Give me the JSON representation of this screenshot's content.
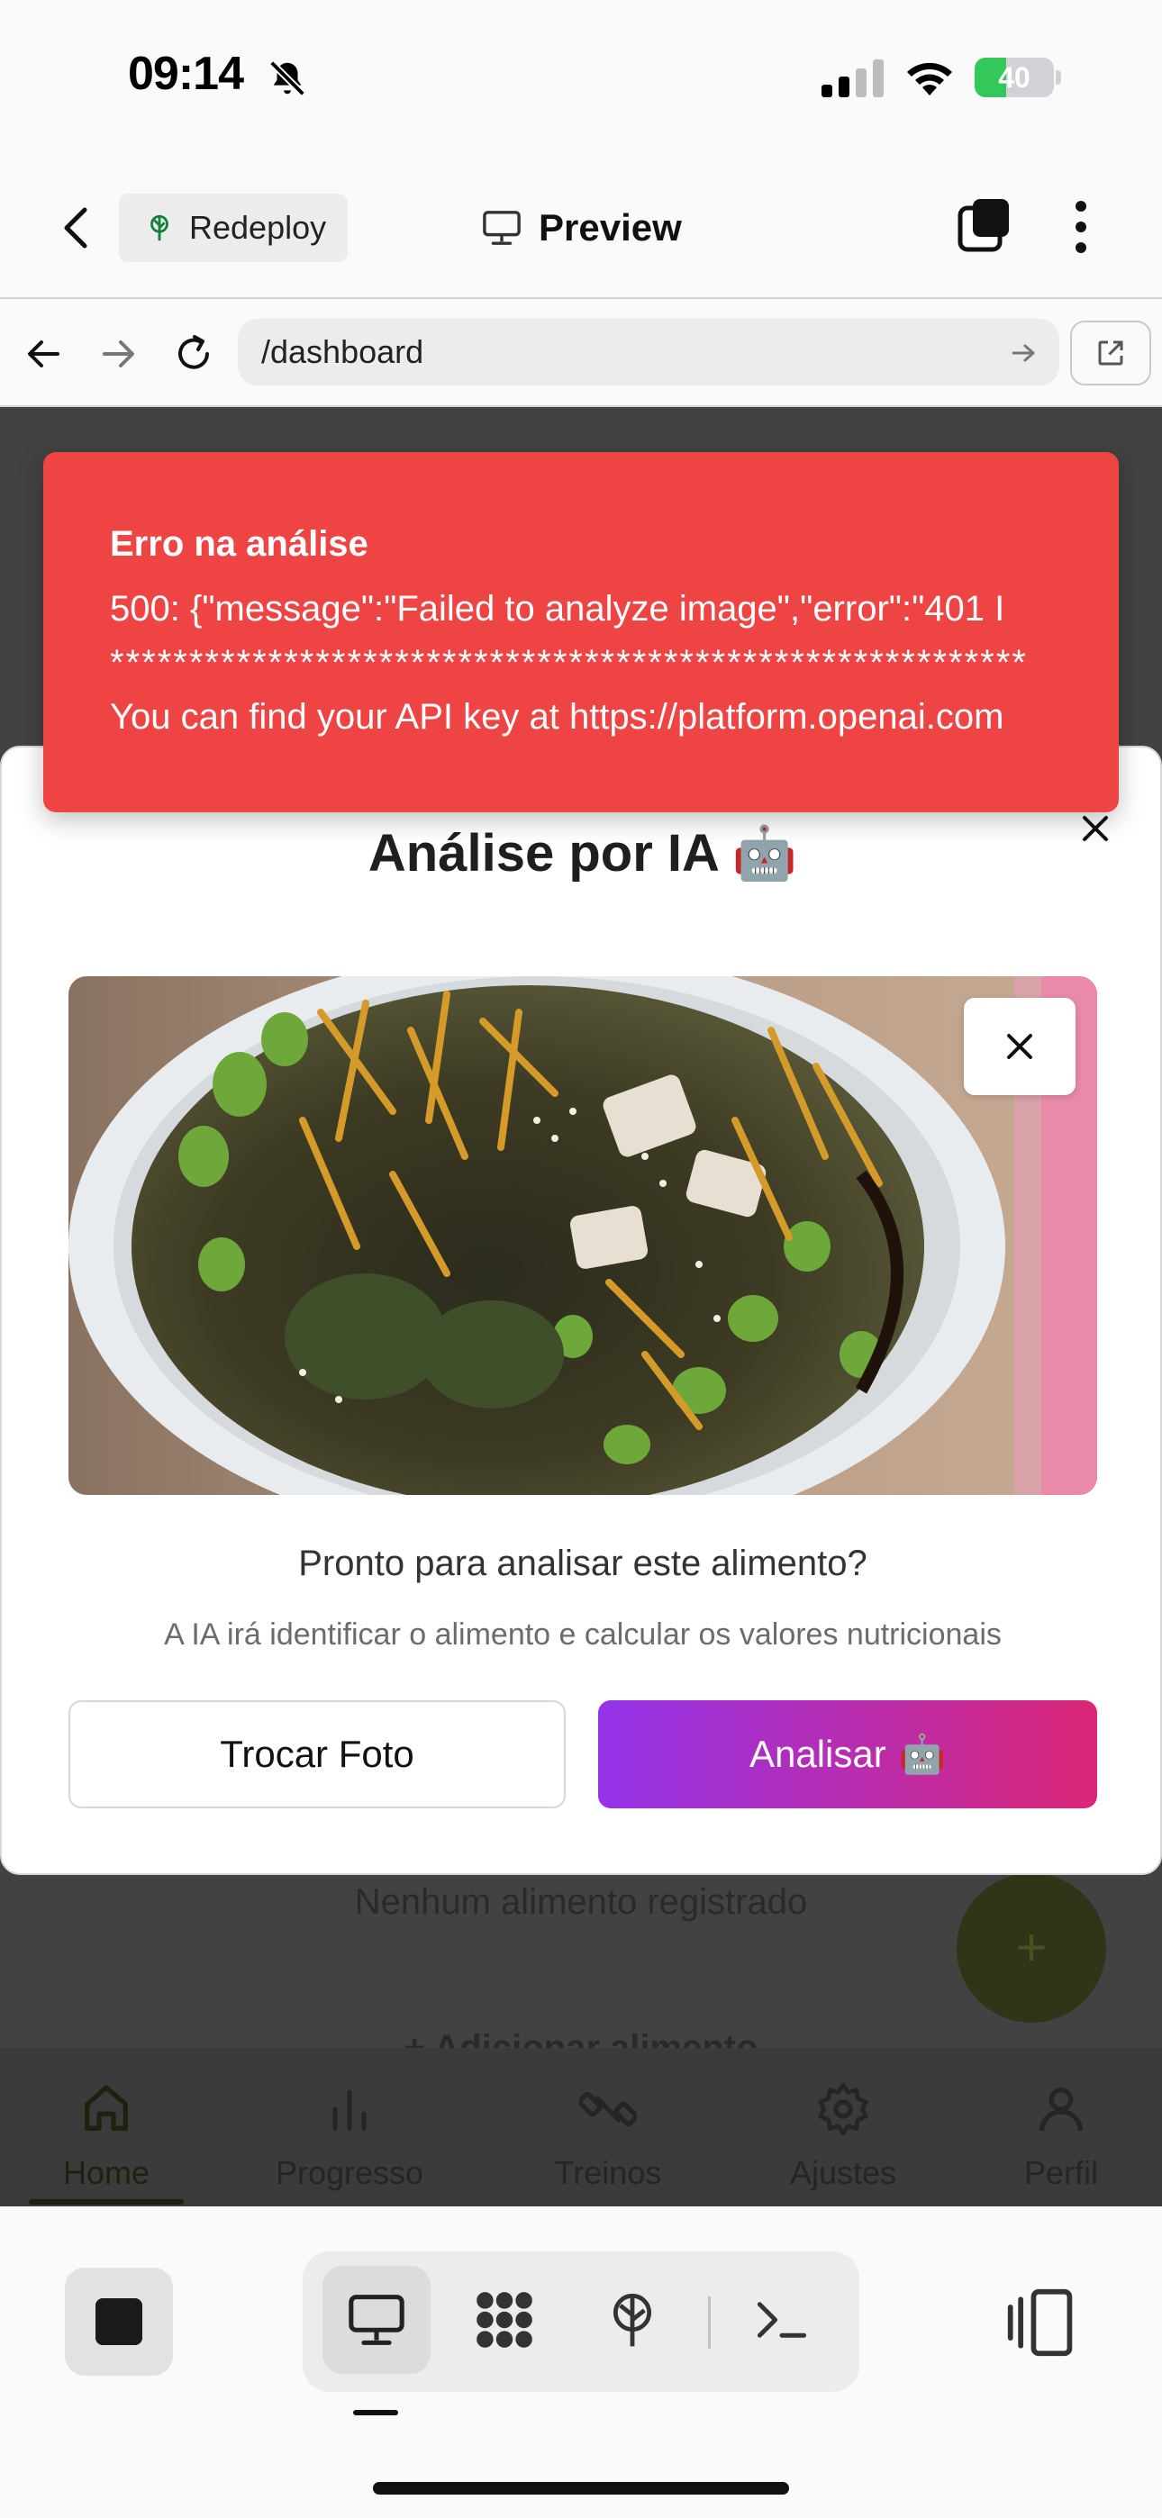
{
  "status_bar": {
    "time": "09:14",
    "battery": "40",
    "battery_level": 0.4
  },
  "header": {
    "redeploy_label": "Redeploy",
    "preview_label": "Preview"
  },
  "browser": {
    "url": "/dashboard"
  },
  "toast": {
    "title": "Erro na análise",
    "line1": "500: {\"message\":\"Failed to analyze image\",\"error\":\"401 I",
    "line2": "**********************************************************",
    "line3": "You can find your API key at https://platform.openai.com"
  },
  "modal": {
    "title": "Análise por IA 🤖",
    "prompt": "Pronto para analisar este alimento?",
    "hint": "A IA irá identificar o alimento e calcular os valores nutricionais",
    "change_photo_label": "Trocar Foto",
    "analyze_label": "Analisar",
    "analyze_emoji": "🤖"
  },
  "background": {
    "empty_text": "Nenhum alimento registrado",
    "add_text": "+ Adicionar alimento",
    "fab_symbol": "+"
  },
  "bottom_nav": {
    "items": [
      {
        "label": "Home",
        "icon": "home-icon"
      },
      {
        "label": "Progresso",
        "icon": "bar-chart-icon"
      },
      {
        "label": "Treinos",
        "icon": "dumbbell-icon"
      },
      {
        "label": "Ajustes",
        "icon": "gear-icon"
      },
      {
        "label": "Perfil",
        "icon": "user-icon"
      }
    ]
  },
  "toolbar": {
    "tools": [
      "desktop-icon",
      "apps-icon",
      "deploy-icon",
      "terminal-icon"
    ]
  },
  "colors": {
    "toast_bg": "#ef4444",
    "primary_gradient_start": "#9333ea",
    "primary_gradient_end": "#db2777",
    "battery_green": "#34c759",
    "overlay": "#424242"
  }
}
